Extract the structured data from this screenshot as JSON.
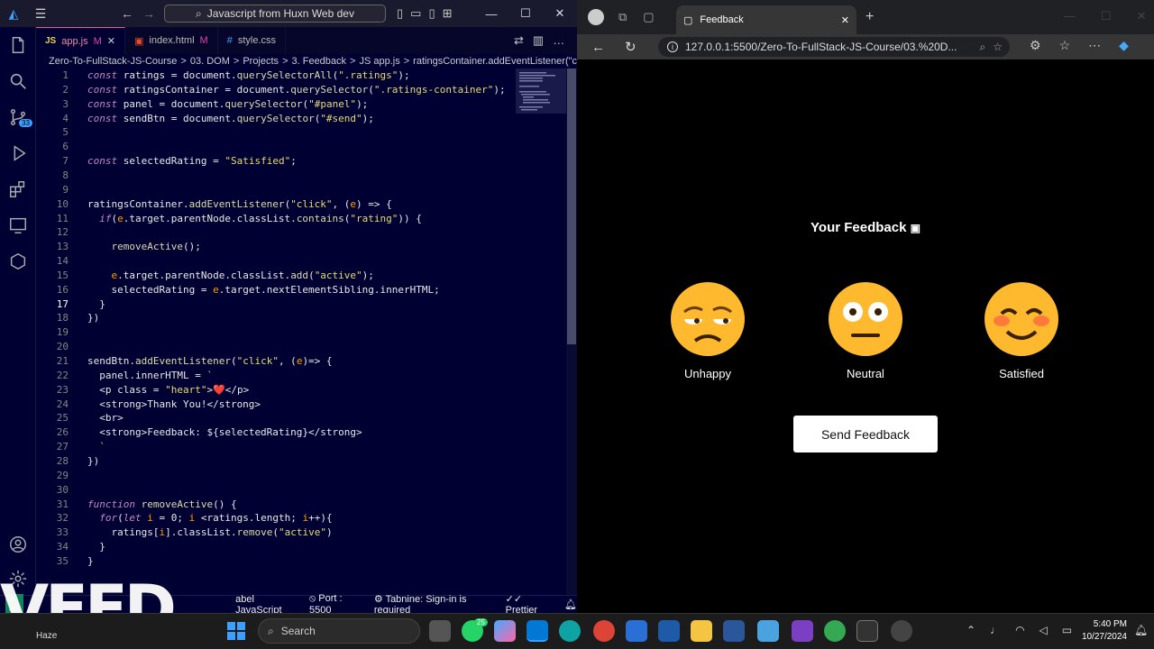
{
  "vscode": {
    "title_search": "Javascript from Huxn Web dev",
    "tabs": [
      {
        "label": "app.js",
        "badge": "M",
        "icon": "JS",
        "active": true
      },
      {
        "label": "index.html",
        "badge": "M",
        "icon": "html"
      },
      {
        "label": "style.css",
        "badge": "",
        "icon": "css"
      }
    ],
    "breadcrumb": [
      "Zero-To-FullStack-JS-Course",
      ">",
      "03. DOM",
      ">",
      "Projects",
      ">",
      "3. Feedback",
      ">",
      "app.js",
      ">",
      "ratingsContainer.addEventListener('click') callback"
    ],
    "breadcrumb_display": [
      "Zero-To-FullStack-JS-Course",
      ">",
      "03. DOM",
      ">",
      "Projects",
      ">",
      "3. Feedback",
      ">",
      "JS app.js",
      ">",
      "ratingsContainer.addEventListener(\"click\""
    ],
    "activity_badge": "33",
    "code_lines": [
      "const ratings = document.querySelectorAll(\".ratings\");",
      "const ratingsContainer = document.querySelector(\".ratings-container\");",
      "const panel = document.querySelector(\"#panel\");",
      "const sendBtn = document.querySelector(\"#send\");",
      "",
      "",
      "const selectedRating = \"Satisfied\";",
      "",
      "",
      "ratingsContainer.addEventListener(\"click\", (e) => {",
      "  if(e.target.parentNode.classList.contains(\"rating\")) {",
      "",
      "    removeActive();",
      "",
      "    e.target.parentNode.classList.add(\"active\");",
      "    selectedRating = e.target.nextElementSibling.innerHTML;",
      "  }",
      "})",
      "",
      "",
      "sendBtn.addEventListener(\"click\", (e)=> {",
      "  panel.innerHTML = `",
      "  <p class = \"heart\">❤️</p>",
      "  <strong>Thank You!</strong>",
      "  <br>",
      "  <strong>Feedback: ${selectedRating}</strong>",
      "  `",
      "})",
      "",
      "",
      "function removeActive() {",
      "  for(let i = 0; i <ratings.length; i++){",
      "    ratings[i].classList.remove(\"active\")",
      "  }",
      "}"
    ],
    "status": {
      "left_icon": "><",
      "language": "abel JavaScript",
      "port": "Port : 5500",
      "tabnine": "Tabnine: Sign-in is required",
      "prettier": "Prettier"
    },
    "overlay_logo": "VEED"
  },
  "browser": {
    "tab_title": "Feedback",
    "url": "127.0.0.1:5500/Zero-To-FullStack-JS-Course/03.%20D...",
    "page": {
      "title": "Your Feedback",
      "ratings": [
        {
          "label": "Unhappy",
          "emoji": "unamused-face"
        },
        {
          "label": "Neutral",
          "emoji": "neutral-face"
        },
        {
          "label": "Satisfied",
          "emoji": "smiling-blushing-face"
        }
      ],
      "send_label": "Send Feedback"
    }
  },
  "taskbar": {
    "weather": "Haze",
    "search_placeholder": "Search",
    "time": "5:40 PM",
    "date": "10/27/2024",
    "whatsapp_badge": "25"
  }
}
